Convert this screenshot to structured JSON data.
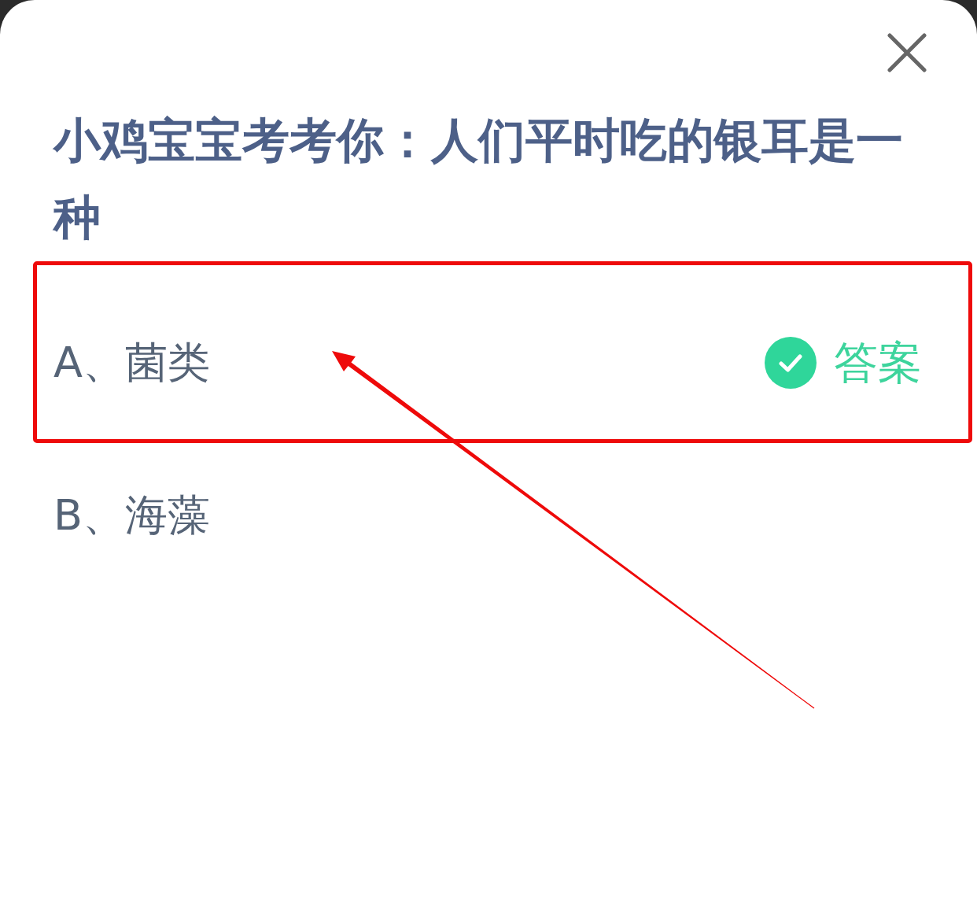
{
  "dialog": {
    "title": "小鸡宝宝考考你：人们平时吃的银耳是一种",
    "options": [
      {
        "label": "A、菌类",
        "correct": true,
        "badge": "答案",
        "highlighted": true
      },
      {
        "label": "B、海藻",
        "correct": false,
        "highlighted": false
      }
    ]
  },
  "annotations": [
    {
      "kind": "arrow"
    }
  ]
}
